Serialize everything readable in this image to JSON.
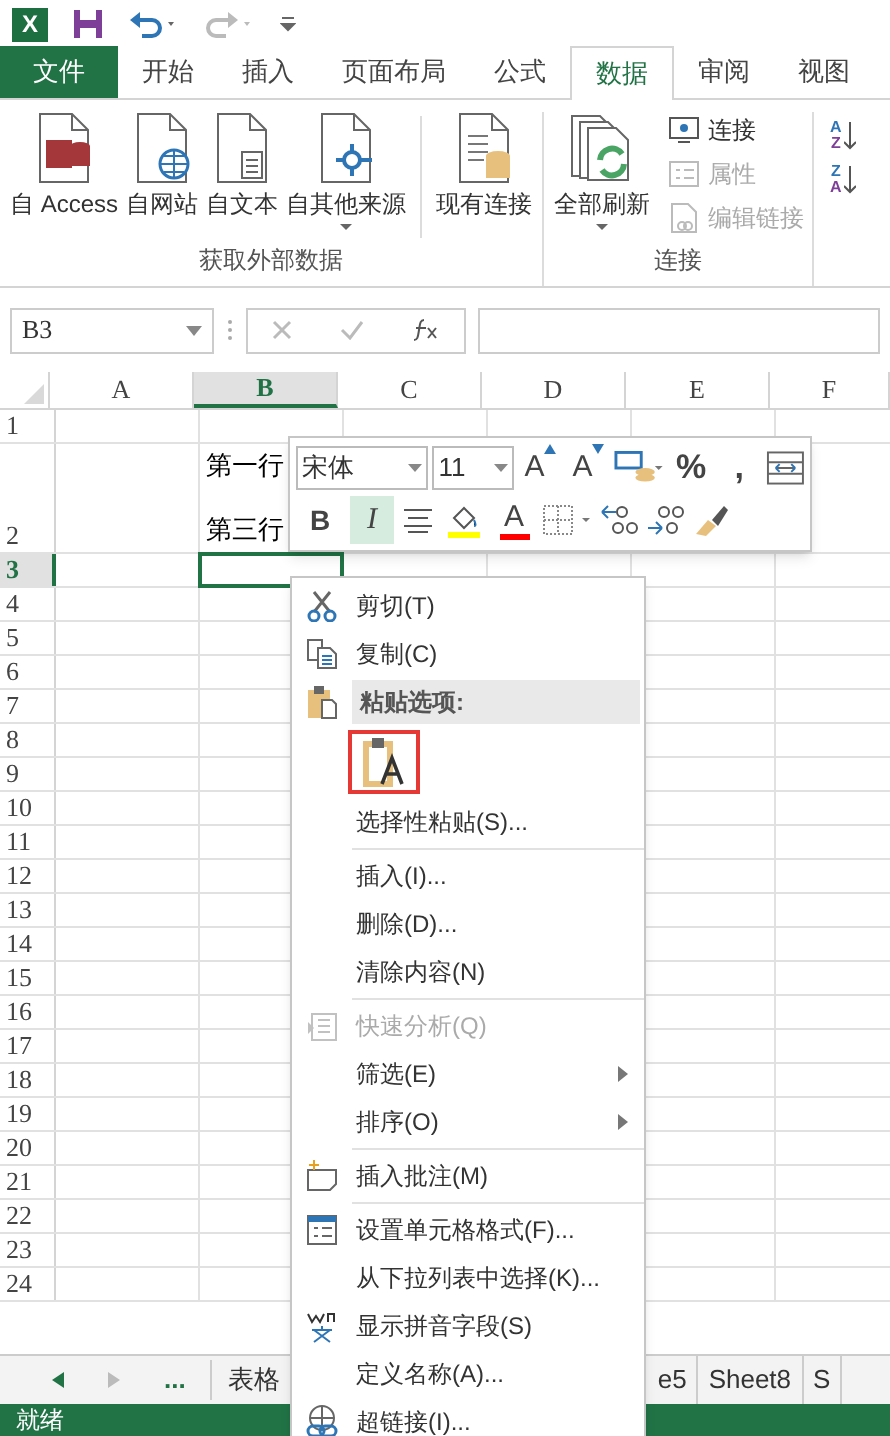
{
  "quick_access": {
    "logo_letter": "X",
    "redo_disabled": true
  },
  "ribbon": {
    "tabs": [
      {
        "label": "文件",
        "kind": "file",
        "selected": false
      },
      {
        "label": "开始",
        "kind": "tab",
        "selected": false
      },
      {
        "label": "插入",
        "kind": "tab",
        "selected": false
      },
      {
        "label": "页面布局",
        "kind": "tab",
        "selected": false
      },
      {
        "label": "公式",
        "kind": "tab",
        "selected": false
      },
      {
        "label": "数据",
        "kind": "tab",
        "selected": true
      },
      {
        "label": "审阅",
        "kind": "tab",
        "selected": false
      },
      {
        "label": "视图",
        "kind": "tab",
        "selected": false
      }
    ],
    "groups": [
      {
        "title": "获取外部数据",
        "buttons": [
          {
            "label": "自 Access",
            "kind": "access"
          },
          {
            "label": "自网站",
            "kind": "web"
          },
          {
            "label": "自文本",
            "kind": "text"
          },
          {
            "label": "自其他来源",
            "kind": "other",
            "dropdown": true
          },
          {
            "label": "现有连接",
            "kind": "existing"
          }
        ]
      },
      {
        "title": "连接",
        "buttons": [
          {
            "label": "全部刷新",
            "kind": "refresh",
            "dropdown": true
          }
        ],
        "small_buttons": [
          {
            "label": "连接",
            "kind": "connections",
            "disabled": false
          },
          {
            "label": "属性",
            "kind": "properties",
            "disabled": true
          },
          {
            "label": "编辑链接",
            "kind": "links",
            "disabled": true
          }
        ]
      }
    ],
    "sort_buttons": [
      {
        "top": "A",
        "bottom": "Z"
      },
      {
        "top": "Z",
        "bottom": "A"
      }
    ]
  },
  "name_box": "B3",
  "columns": [
    {
      "label": "A",
      "selected": false
    },
    {
      "label": "B",
      "selected": true
    },
    {
      "label": "C",
      "selected": false
    },
    {
      "label": "D",
      "selected": false
    },
    {
      "label": "E",
      "selected": false
    },
    {
      "label": "F",
      "selected": false
    }
  ],
  "rows": [
    {
      "label": "1",
      "selected": false
    },
    {
      "label": "2",
      "selected": false,
      "cell_b": {
        "lines": [
          "第一行",
          "第三行"
        ]
      }
    },
    {
      "label": "3",
      "selected": true,
      "cell_b": {
        "active": true
      }
    },
    {
      "label": "4",
      "selected": false
    },
    {
      "label": "5",
      "selected": false
    },
    {
      "label": "6",
      "selected": false
    },
    {
      "label": "7",
      "selected": false
    },
    {
      "label": "8",
      "selected": false
    },
    {
      "label": "9",
      "selected": false
    },
    {
      "label": "10",
      "selected": false
    },
    {
      "label": "11",
      "selected": false
    },
    {
      "label": "12",
      "selected": false
    },
    {
      "label": "13",
      "selected": false
    },
    {
      "label": "14",
      "selected": false
    },
    {
      "label": "15",
      "selected": false
    },
    {
      "label": "16",
      "selected": false
    },
    {
      "label": "17",
      "selected": false
    },
    {
      "label": "18",
      "selected": false
    },
    {
      "label": "19",
      "selected": false
    },
    {
      "label": "20",
      "selected": false
    },
    {
      "label": "21",
      "selected": false
    },
    {
      "label": "22",
      "selected": false
    },
    {
      "label": "23",
      "selected": false
    },
    {
      "label": "24",
      "selected": false
    }
  ],
  "mini_toolbar": {
    "font": "宋体",
    "size": "11",
    "row_1": [
      {
        "kind": "grow",
        "label": "A"
      },
      {
        "kind": "shrink",
        "label": "A"
      },
      {
        "kind": "accounting"
      },
      {
        "kind": "text",
        "label": "%"
      },
      {
        "kind": "text",
        "label": ","
      },
      {
        "kind": "wrap"
      }
    ],
    "row_2": [
      {
        "kind": "bold",
        "label": "B",
        "selected": false
      },
      {
        "kind": "italic",
        "label": "I",
        "selected": true
      },
      {
        "kind": "align"
      },
      {
        "kind": "fill",
        "color": "#ffff00"
      },
      {
        "kind": "font_color",
        "label": "A",
        "color": "#ff0000"
      },
      {
        "kind": "borders"
      },
      {
        "kind": "decimal_increase"
      },
      {
        "kind": "decimal_decrease"
      },
      {
        "kind": "painter"
      }
    ]
  },
  "context_menu": [
    {
      "kind": "cut",
      "label": "剪切(T)",
      "disabled": false
    },
    {
      "kind": "copy",
      "label": "复制(C)",
      "disabled": false
    },
    {
      "kind": "paste_header",
      "label": "粘贴选项:"
    },
    {
      "kind": "paste_options",
      "options": [
        {
          "selected": true
        }
      ]
    },
    {
      "kind": "plain",
      "label": "选择性粘贴(S)...",
      "disabled": false
    },
    {
      "kind": "separator"
    },
    {
      "kind": "plain",
      "label": "插入(I)...",
      "disabled": false
    },
    {
      "kind": "plain",
      "label": "删除(D)...",
      "disabled": false
    },
    {
      "kind": "plain",
      "label": "清除内容(N)",
      "disabled": false
    },
    {
      "kind": "separator"
    },
    {
      "kind": "quick_analysis",
      "label": "快速分析(Q)",
      "disabled": true
    },
    {
      "kind": "plain",
      "label": "筛选(E)",
      "disabled": false,
      "submenu": true
    },
    {
      "kind": "plain",
      "label": "排序(O)",
      "disabled": false,
      "submenu": true
    },
    {
      "kind": "separator"
    },
    {
      "kind": "comment",
      "label": "插入批注(M)",
      "disabled": false
    },
    {
      "kind": "separator"
    },
    {
      "kind": "format",
      "label": "设置单元格格式(F)...",
      "disabled": false
    },
    {
      "kind": "plain",
      "label": "从下拉列表中选择(K)...",
      "disabled": false
    },
    {
      "kind": "phonetic",
      "label": "显示拼音字段(S)",
      "disabled": false
    },
    {
      "kind": "plain",
      "label": "定义名称(A)...",
      "disabled": false
    },
    {
      "kind": "link",
      "label": "超链接(I)...",
      "disabled": false
    }
  ],
  "sheet_tabs": {
    "more": "...",
    "tabs": [
      {
        "label": "表格"
      },
      {
        "label": "e5"
      },
      {
        "label": "Sheet8"
      },
      {
        "label": "S"
      }
    ]
  },
  "status_bar": "就绪"
}
